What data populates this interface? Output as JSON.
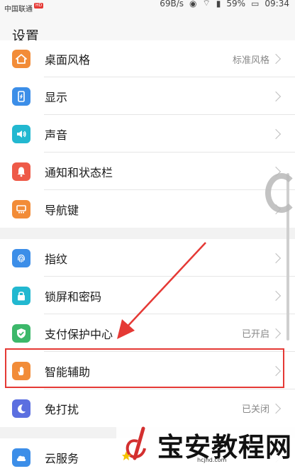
{
  "status_bar": {
    "carrier": "中国联通",
    "carrier_badge": "HD",
    "speed": "69B/s",
    "battery": "59%",
    "time": "09:34"
  },
  "header": {
    "title": "设置"
  },
  "groups": [
    {
      "items": [
        {
          "label": "桌面风格",
          "value": "标准风格",
          "icon": "home-icon",
          "color": "#f28c38"
        },
        {
          "label": "显示",
          "value": "",
          "icon": "display-icon",
          "color": "#3c8ee8"
        },
        {
          "label": "声音",
          "value": "",
          "icon": "sound-icon",
          "color": "#22b8d0"
        },
        {
          "label": "通知和状态栏",
          "value": "",
          "icon": "bell-icon",
          "color": "#ee5a48"
        },
        {
          "label": "导航键",
          "value": "",
          "icon": "navigation-key-icon",
          "color": "#f28c38"
        }
      ]
    },
    {
      "items": [
        {
          "label": "指纹",
          "value": "",
          "icon": "fingerprint-icon",
          "color": "#3c8ee8"
        },
        {
          "label": "锁屏和密码",
          "value": "",
          "icon": "lock-icon",
          "color": "#22b8d0"
        },
        {
          "label": "支付保护中心",
          "value": "已开启",
          "icon": "shield-check-icon",
          "color": "#3cb86a"
        },
        {
          "label": "智能辅助",
          "value": "",
          "icon": "hand-icon",
          "color": "#f28c38"
        },
        {
          "label": "免打扰",
          "value": "已关闭",
          "icon": "moon-icon",
          "color": "#5c6fe0"
        }
      ]
    },
    {
      "items": [
        {
          "label": "云服务",
          "value": "",
          "icon": "cloud-icon",
          "color": "#3c8ee8"
        }
      ]
    }
  ],
  "watermark": {
    "text": "宝安教程网",
    "url": "hcjhd.com"
  },
  "colors": {
    "highlight": "#e53935",
    "arrow": "#e53935"
  }
}
